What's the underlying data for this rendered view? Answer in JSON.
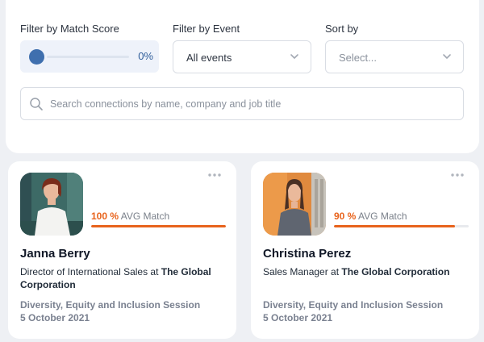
{
  "filters": {
    "match_score": {
      "label": "Filter by Match Score",
      "value": "0%",
      "level": 0
    },
    "event": {
      "label": "Filter by Event",
      "value": "All events"
    },
    "sort": {
      "label": "Sort by",
      "placeholder": "Select..."
    },
    "search": {
      "placeholder": "Search connections by name, company and job title",
      "value": ""
    }
  },
  "colors": {
    "accent": "#e8631c",
    "knob": "#3f6fae",
    "page_bg": "#eef0f4"
  },
  "icons": {
    "more": "more-dots-icon",
    "chevron": "chevron-down-icon",
    "search": "search-icon"
  },
  "cards": [
    {
      "match_pct": "100 %",
      "match_label": "AVG Match",
      "match_value": 100,
      "name": "Janna Berry",
      "title_prefix": "Director of International Sales at",
      "company": "The Global Corporation",
      "event_name": "Diversity, Equity and Inclusion Session",
      "event_date": "5 October 2021"
    },
    {
      "match_pct": "90 %",
      "match_label": "AVG Match",
      "match_value": 90,
      "name": "Christina Perez",
      "title_prefix": "Sales Manager at",
      "company": "The Global Corporation",
      "event_name": "Diversity, Equity and Inclusion Session",
      "event_date": "5 October 2021"
    }
  ]
}
